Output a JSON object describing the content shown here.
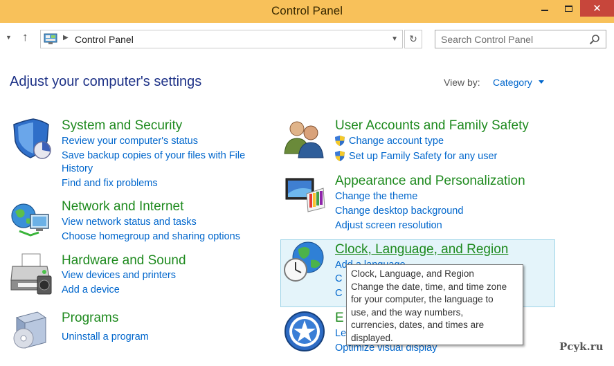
{
  "window": {
    "title": "Control Panel",
    "controls": {
      "minimize": "minimize",
      "maximize": "maximize",
      "close": "✕"
    }
  },
  "address": {
    "breadcrumb": "Control Panel",
    "search_placeholder": "Search Control Panel"
  },
  "main": {
    "heading": "Adjust your computer's settings",
    "view_by_label": "View by:",
    "view_by_value": "Category"
  },
  "categories": {
    "system": {
      "title": "System and Security",
      "links": [
        "Review your computer's status",
        "Save backup copies of your files with File",
        "History",
        "Find and fix problems"
      ]
    },
    "network": {
      "title": "Network and Internet",
      "links": [
        "View network status and tasks",
        "Choose homegroup and sharing options"
      ]
    },
    "hardware": {
      "title": "Hardware and Sound",
      "links": [
        "View devices and printers",
        "Add a device"
      ]
    },
    "programs": {
      "title": "Programs",
      "links": [
        "Uninstall a program"
      ]
    },
    "users": {
      "title": "User Accounts and Family Safety",
      "links": [
        "Change account type",
        "Set up Family Safety for any user"
      ]
    },
    "appearance": {
      "title": "Appearance and Personalization",
      "links": [
        "Change the theme",
        "Change desktop background",
        "Adjust screen resolution"
      ]
    },
    "clock": {
      "title": "Clock, Language, and Region",
      "links": [
        "Add a language",
        "C",
        "C"
      ]
    },
    "ease": {
      "title": "E",
      "links": [
        "Le",
        "Optimize visual display"
      ]
    }
  },
  "tooltip": {
    "lines": [
      "Clock, Language, and Region",
      "Change the date, time, and time zone",
      "for your computer, the language to",
      "use, and the way numbers,",
      "currencies, dates, and times are",
      "displayed."
    ]
  },
  "watermark": "Pcyk.ru",
  "colors": {
    "titlebar": "#f8c15a",
    "close_button": "#c7463b",
    "heading": "#1e3287",
    "category_title": "#1e8a1e",
    "link": "#0066cc",
    "hover_bg": "#e4f4fa"
  },
  "icons": {
    "system": "shield-chart-icon",
    "network": "globe-network-icon",
    "hardware": "printer-icon",
    "programs": "programs-box-icon",
    "users": "users-icon",
    "appearance": "monitor-palette-icon",
    "clock": "clock-globe-icon",
    "ease": "ease-of-access-icon",
    "uac": "uac-shield-icon"
  }
}
